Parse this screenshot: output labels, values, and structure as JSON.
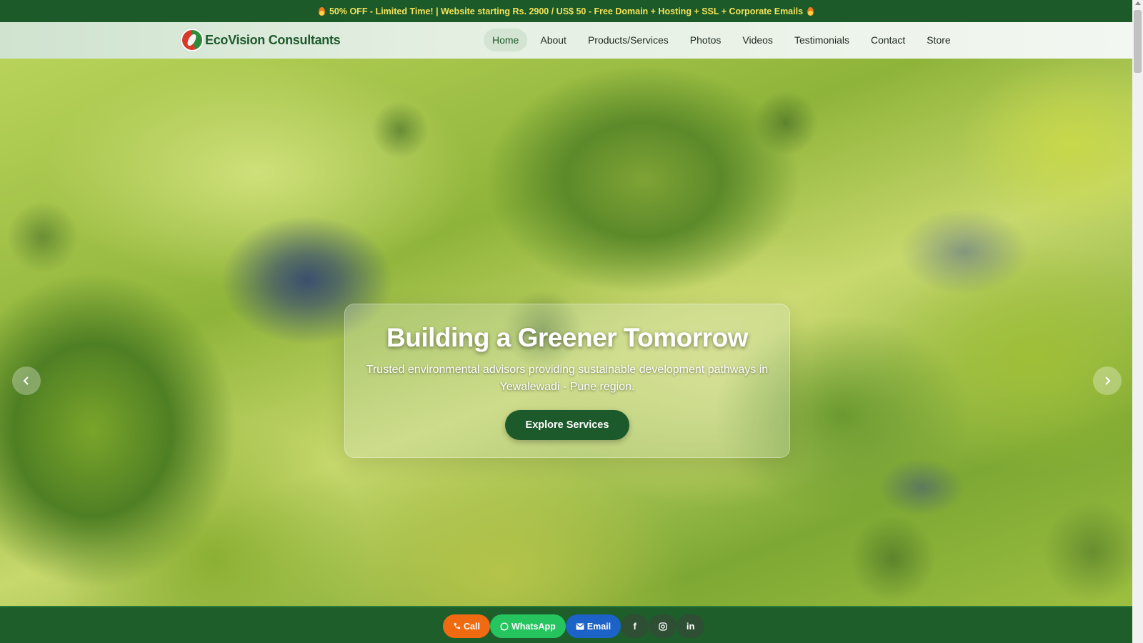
{
  "promo": {
    "text": "50% OFF - Limited Time! | Website starting Rs. 2900 / US$ 50 - Free Domain + Hosting + SSL + Corporate Emails",
    "icon_left": "flame-icon",
    "icon_right": "flame-icon"
  },
  "brand": {
    "name": "EcoVision Consultants",
    "logo_icon": "leaf-logo-icon"
  },
  "nav": {
    "items": [
      "Home",
      "About",
      "Products/Services",
      "Photos",
      "Videos",
      "Testimonials",
      "Contact",
      "Store"
    ],
    "active": "Home"
  },
  "hero": {
    "title": "Building a Greener Tomorrow",
    "subtitle": "Trusted environmental advisors providing sustainable development pathways in Yewalewadi - Pune region.",
    "cta": "Explore Services",
    "prev_icon": "chevron-left-icon",
    "next_icon": "chevron-right-icon"
  },
  "actions": {
    "call": "Call",
    "whatsapp": "WhatsApp",
    "email": "Email",
    "social": [
      "facebook-icon",
      "instagram-icon",
      "linkedin-icon"
    ]
  },
  "colors": {
    "primary_green": "#1d5e2a",
    "promo_text": "#f3e35a",
    "call": "#f06a12",
    "whatsapp": "#25c45e",
    "email": "#1c62c7"
  }
}
